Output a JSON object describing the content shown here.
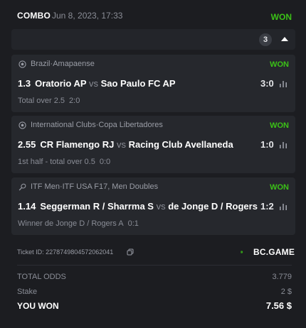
{
  "header": {
    "type": "COMBO",
    "date": "Jun 8, 2023, 17:33",
    "status": "WON"
  },
  "selections_count": "3",
  "selections": [
    {
      "sport_icon": "soccer-ball-icon",
      "country": "Brazil",
      "league": "Amapaense",
      "result": "WON",
      "odds": "1.3",
      "home": "Oratorio AP",
      "vs": "vs",
      "away": "Sao Paulo FC AP",
      "score": "3:0",
      "market": "Total over 2.5",
      "market_score": "2:0"
    },
    {
      "sport_icon": "soccer-ball-icon",
      "country": "International Clubs",
      "league": "Copa Libertadores",
      "result": "WON",
      "odds": "2.55",
      "home": "CR Flamengo RJ",
      "vs": "vs",
      "away": "Racing Club Avellaneda",
      "score": "1:0",
      "market": "1st half - total over 0.5",
      "market_score": "0:0"
    },
    {
      "sport_icon": "tennis-racket-icon",
      "country": "ITF Men",
      "league": "ITF USA F17, Men Doubles",
      "result": "WON",
      "odds": "1.14",
      "home": "Seggerman R / Sharrma S",
      "vs": "vs",
      "away": "de Jonge D / Rogers A",
      "score": "1:2",
      "market": "Winner de Jonge D / Rogers A",
      "market_score": "0:1"
    }
  ],
  "ticket": {
    "label": "Ticket ID: 2278749804572062041",
    "brand": "BC.GAME"
  },
  "summary": {
    "total_odds_label": "TOTAL ODDS",
    "total_odds_value": "3.779",
    "stake_label": "Stake",
    "stake_value": "2 $",
    "won_label": "YOU WON",
    "won_value": "7.56 $"
  },
  "colors": {
    "background": "#1c1d21",
    "card": "#26282d",
    "won_green": "#3bc117",
    "muted_text": "#8a8d96"
  }
}
